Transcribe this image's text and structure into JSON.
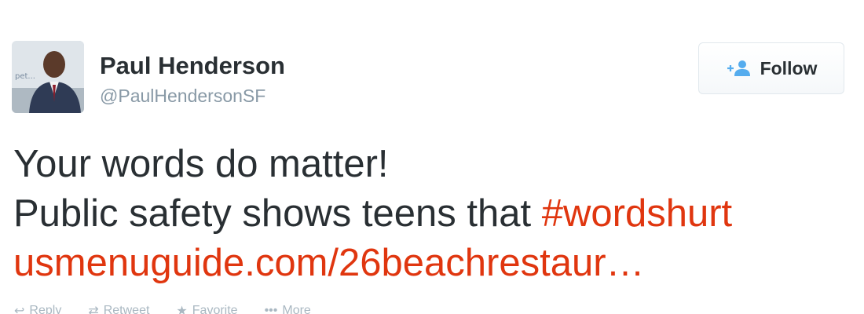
{
  "user": {
    "name": "Paul Henderson",
    "handle": "@PaulHendersonSF",
    "avatar_sign_text": "pet..."
  },
  "follow": {
    "label": "Follow",
    "icon": "add-person-icon",
    "icon_color": "#55acee"
  },
  "tweet": {
    "line1": "Your words do matter!",
    "line2_text": "Public safety shows teens that ",
    "hashtag": "#wordshurt",
    "link": "usmenuguide.com/26beachrestaur…"
  },
  "actions": [
    {
      "label": "Reply",
      "icon": "reply-icon"
    },
    {
      "label": "Retweet",
      "icon": "retweet-icon"
    },
    {
      "label": "Favorite",
      "icon": "star-icon"
    },
    {
      "label": "More",
      "icon": "more-icon"
    }
  ],
  "colors": {
    "text": "#292f33",
    "secondary": "#8899a6",
    "link": "#e0360f",
    "border": "#e1e8ed"
  }
}
